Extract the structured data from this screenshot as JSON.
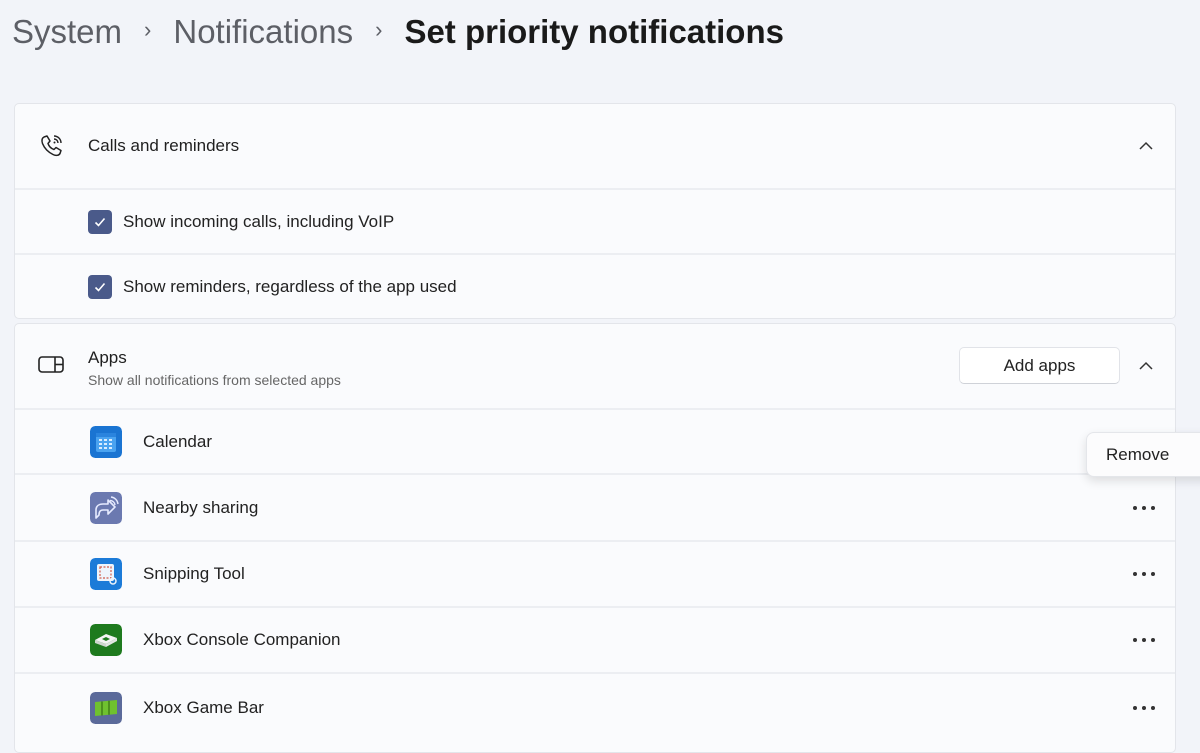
{
  "breadcrumb": [
    {
      "label": "System"
    },
    {
      "label": "Notifications"
    },
    {
      "label": "Set priority notifications"
    }
  ],
  "calls_section": {
    "icon": "phone-ringing-icon",
    "title": "Calls and reminders",
    "expanded": true,
    "options": [
      {
        "label": "Show incoming calls, including VoIP",
        "checked": true
      },
      {
        "label": "Show reminders, regardless of the app used",
        "checked": true
      }
    ]
  },
  "apps_section": {
    "icon": "app-window-icon",
    "title": "Apps",
    "subtitle": "Show all notifications from selected apps",
    "add_button_label": "Add apps",
    "expanded": true,
    "apps": [
      {
        "name": "Calendar",
        "icon": "calendar-icon"
      },
      {
        "name": "Nearby sharing",
        "icon": "nearby-sharing-icon"
      },
      {
        "name": "Snipping Tool",
        "icon": "snipping-tool-icon"
      },
      {
        "name": "Xbox Console Companion",
        "icon": "xbox-console-companion-icon"
      },
      {
        "name": "Xbox Game Bar",
        "icon": "xbox-game-bar-icon"
      }
    ]
  },
  "context_menu": {
    "items": [
      {
        "label": "Remove"
      }
    ]
  },
  "colors": {
    "checkbox_accent": "#4a5a8a",
    "background": "#f2f4f9",
    "card": "#fafbfd"
  }
}
